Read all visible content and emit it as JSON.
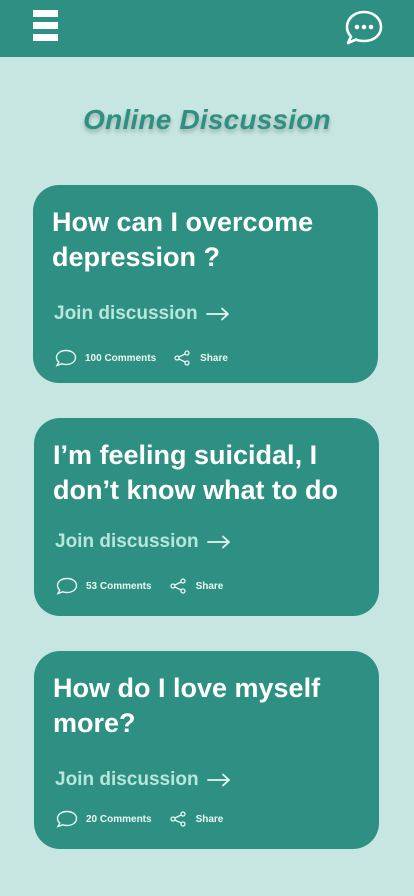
{
  "header": {
    "menu_icon": "hamburger-menu-icon",
    "chat_icon": "chat-bubble-icon"
  },
  "page": {
    "title": "Online Discussion"
  },
  "discussions": [
    {
      "question": "How can I overcome depression ?",
      "join_label": "Join discussion",
      "comments": "100 Comments",
      "share": "Share"
    },
    {
      "question": "I’m feeling suicidal, I don’t know what to do",
      "join_label": "Join discussion",
      "comments": "53 Comments",
      "share": "Share"
    },
    {
      "question": "How do I love myself more?",
      "join_label": "Join discussion",
      "comments": "20 Comments",
      "share": "Share"
    }
  ],
  "colors": {
    "background": "#c8e6e1",
    "primary": "#2e9083",
    "join_text": "#b8e5dc"
  }
}
